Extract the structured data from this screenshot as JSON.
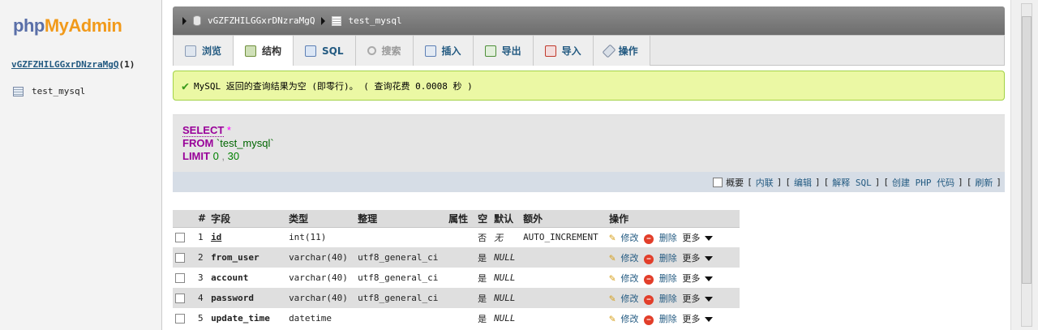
{
  "sidebar": {
    "logo_part1": "php",
    "logo_part2": "MyAdmin",
    "db_name": "vGZFZHILGGxrDNzraMgQ",
    "db_count": "(1)",
    "table_name": "test_mysql"
  },
  "breadcrumb": {
    "db": "vGZFZHILGGxrDNzraMgQ",
    "table": "test_mysql"
  },
  "tabs": [
    {
      "label": "浏览",
      "icon": "browse-icon",
      "state": "normal"
    },
    {
      "label": "结构",
      "icon": "structure-icon",
      "state": "active"
    },
    {
      "label": "SQL",
      "icon": "sql-icon",
      "state": "normal"
    },
    {
      "label": "搜索",
      "icon": "search-icon",
      "state": "disabled"
    },
    {
      "label": "插入",
      "icon": "insert-icon",
      "state": "normal"
    },
    {
      "label": "导出",
      "icon": "export-icon",
      "state": "normal"
    },
    {
      "label": "导入",
      "icon": "import-icon",
      "state": "normal"
    },
    {
      "label": "操作",
      "icon": "wrench-icon",
      "state": "normal"
    }
  ],
  "message": "MySQL 返回的查询结果为空 (即零行)。 ( 查询花费 0.0008 秒 )",
  "sql": {
    "select": "SELECT",
    "star": "*",
    "from": "FROM",
    "table": "`test_mysql`",
    "limit": "LIMIT",
    "offset": "0",
    "comma": ",",
    "count": "30"
  },
  "sql_actions": {
    "profile": "概要",
    "inline": "内联",
    "edit": "编辑",
    "explain": "解释 SQL",
    "create_php": "创建 PHP 代码",
    "refresh": "刷新"
  },
  "structure": {
    "headers": [
      "#",
      "字段",
      "类型",
      "整理",
      "属性",
      "空",
      "默认",
      "额外",
      "操作"
    ],
    "actions": {
      "edit": "修改",
      "delete": "删除",
      "more": "更多"
    },
    "rows": [
      {
        "num": "1",
        "field": "id",
        "type": "int(11)",
        "collation": "",
        "attr": "",
        "null": "否",
        "default": "无",
        "extra": "AUTO_INCREMENT",
        "pk": true
      },
      {
        "num": "2",
        "field": "from_user",
        "type": "varchar(40)",
        "collation": "utf8_general_ci",
        "attr": "",
        "null": "是",
        "default": "NULL",
        "extra": "",
        "pk": false
      },
      {
        "num": "3",
        "field": "account",
        "type": "varchar(40)",
        "collation": "utf8_general_ci",
        "attr": "",
        "null": "是",
        "default": "NULL",
        "extra": "",
        "pk": false
      },
      {
        "num": "4",
        "field": "password",
        "type": "varchar(40)",
        "collation": "utf8_general_ci",
        "attr": "",
        "null": "是",
        "default": "NULL",
        "extra": "",
        "pk": false
      },
      {
        "num": "5",
        "field": "update_time",
        "type": "datetime",
        "collation": "",
        "attr": "",
        "null": "是",
        "default": "NULL",
        "extra": "",
        "pk": false
      }
    ]
  }
}
